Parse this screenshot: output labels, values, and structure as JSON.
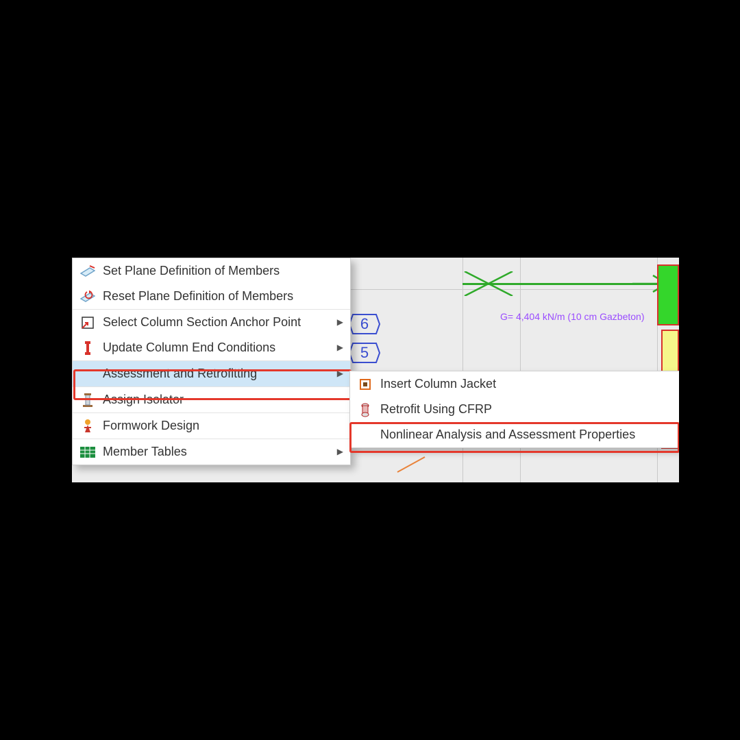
{
  "menu": {
    "items": [
      {
        "label": "Set Plane Definition of Members",
        "icon": "plane-set-icon",
        "submenu": false
      },
      {
        "label": "Reset Plane Definition of Members",
        "icon": "plane-reset-icon",
        "submenu": false
      },
      {
        "label": "Select Column Section Anchor Point",
        "icon": "anchor-point-icon",
        "submenu": true,
        "separator": true
      },
      {
        "label": "Update Column End Conditions",
        "icon": "column-end-icon",
        "submenu": true
      },
      {
        "label": "Assessment and Retrofitting",
        "icon": "",
        "submenu": true,
        "separator": true,
        "hovered": true,
        "highlighted": true
      },
      {
        "label": "Assign Isolator",
        "icon": "isolator-icon",
        "submenu": false,
        "separator": true
      },
      {
        "label": "Formwork Design",
        "icon": "formwork-icon",
        "submenu": false,
        "separator": true
      },
      {
        "label": "Member Tables",
        "icon": "table-icon",
        "submenu": true,
        "separator": true
      }
    ]
  },
  "submenu": {
    "items": [
      {
        "label": "Insert Column Jacket",
        "icon": "column-jacket-icon"
      },
      {
        "label": "Retrofit Using CFRP",
        "icon": "cfrp-icon"
      },
      {
        "label": "Nonlinear Analysis and Assessment Properties",
        "icon": "",
        "hovered": true,
        "highlighted": true
      }
    ]
  },
  "canvas": {
    "note": "G= 4,404 kN/m (10 cm Gazbeton)",
    "labels": [
      "6",
      "5"
    ]
  }
}
